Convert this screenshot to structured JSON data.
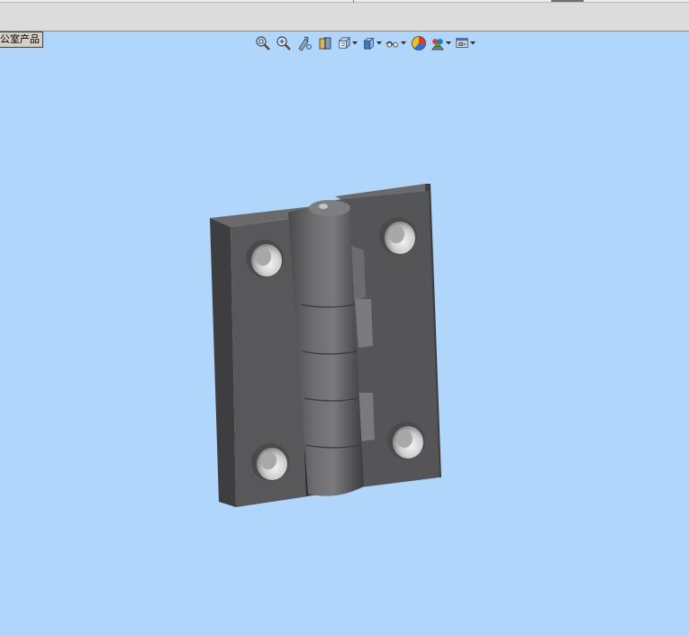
{
  "window": {
    "tree_tab_label": "公室产品"
  },
  "view_toolbar": {
    "buttons": [
      {
        "name": "zoom-to-fit",
        "icon": "zoom-fit-icon",
        "has_dropdown": false
      },
      {
        "name": "zoom-to-area",
        "icon": "zoom-area-icon",
        "has_dropdown": false
      },
      {
        "name": "previous-view",
        "icon": "previous-view-icon",
        "has_dropdown": false
      },
      {
        "name": "section-view",
        "icon": "section-view-icon",
        "has_dropdown": false
      },
      {
        "name": "view-orientation",
        "icon": "view-orientation-icon",
        "has_dropdown": true
      },
      {
        "name": "display-style",
        "icon": "display-style-icon",
        "has_dropdown": true
      },
      {
        "name": "hide-show-items",
        "icon": "hide-show-icon",
        "has_dropdown": true
      },
      {
        "name": "edit-appearance",
        "icon": "appearance-icon",
        "has_dropdown": false
      },
      {
        "name": "apply-scene",
        "icon": "scene-icon",
        "has_dropdown": true
      },
      {
        "name": "view-settings",
        "icon": "view-settings-icon",
        "has_dropdown": true
      }
    ]
  },
  "viewport": {
    "background_color": "#b0d6fc",
    "model": "hinge",
    "model_color": "#58585a"
  }
}
